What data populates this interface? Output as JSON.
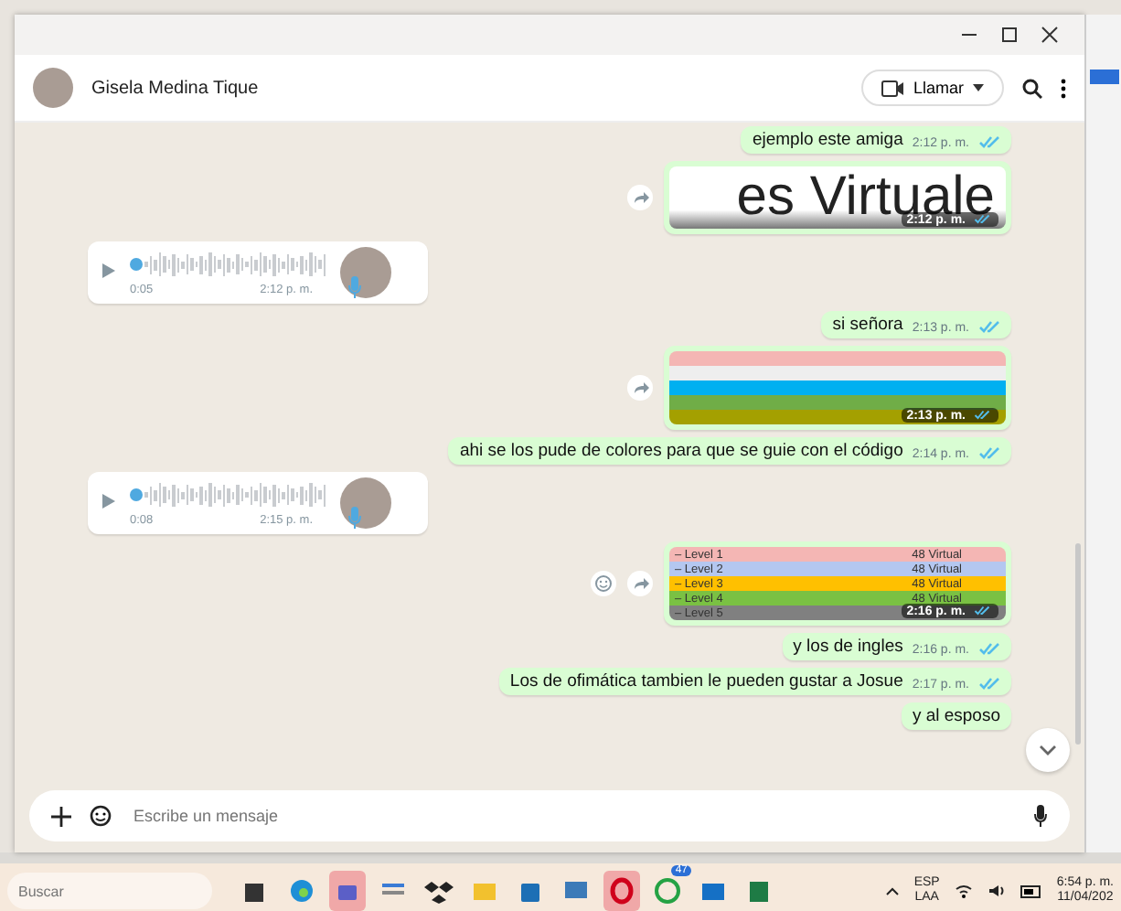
{
  "header": {
    "contact": "Gisela Medina Tique",
    "call_button": "Llamar"
  },
  "messages": [
    {
      "kind": "text",
      "outgoing": true,
      "text": "ejemplo este amiga",
      "time": "2:12 p. m.",
      "read": true
    },
    {
      "kind": "image",
      "outgoing": true,
      "text": "es Virtuale",
      "time": "2:12 p. m.",
      "read": true
    },
    {
      "kind": "audio",
      "outgoing": false,
      "duration": "0:05",
      "time": "2:12 p. m.",
      "level": 0
    },
    {
      "kind": "text",
      "outgoing": true,
      "text": "si señora",
      "time": "2:13 p. m.",
      "read": true
    },
    {
      "kind": "sheet",
      "outgoing": true,
      "time": "2:13 p. m.",
      "read": true,
      "rows": [
        {
          "color": "#f4b6b4"
        },
        {
          "color": "#eeeeee"
        },
        {
          "color": "#00b0f0"
        },
        {
          "color": "#70ad47"
        },
        {
          "color": "#a4a000"
        }
      ]
    },
    {
      "kind": "text",
      "outgoing": true,
      "text": "ahi se los pude de colores para que se guie con el código",
      "time": "2:14 p. m.",
      "read": true
    },
    {
      "kind": "audio",
      "outgoing": false,
      "duration": "0:08",
      "time": "2:15 p. m.",
      "level": 0
    },
    {
      "kind": "levels",
      "outgoing": true,
      "time": "2:16 p. m.",
      "read": true,
      "rows": [
        {
          "label": "– Level 1",
          "value": "48  Virtual",
          "color": "#f4b6b4"
        },
        {
          "label": "– Level 2",
          "value": "48  Virtual",
          "color": "#b4c7f0"
        },
        {
          "label": "– Level 3",
          "value": "48  Virtual",
          "color": "#ffc000"
        },
        {
          "label": "– Level 4",
          "value": "48  Virtual",
          "color": "#7ac143"
        },
        {
          "label": "– Level 5",
          "value": "",
          "color": "#808080"
        }
      ]
    },
    {
      "kind": "text",
      "outgoing": true,
      "text": "y los de ingles",
      "time": "2:16 p. m.",
      "read": true
    },
    {
      "kind": "text",
      "outgoing": true,
      "text": "Los de ofimática tambien le pueden gustar a Josue",
      "time": "2:17 p. m.",
      "read": true
    },
    {
      "kind": "text",
      "outgoing": true,
      "text": "y al esposo"
    }
  ],
  "composer": {
    "placeholder": "Escribe un mensaje"
  },
  "taskbar": {
    "search_placeholder": "Buscar",
    "apps": [
      {
        "kind": "widgets",
        "highlighted": false
      },
      {
        "kind": "edge",
        "highlighted": false
      },
      {
        "kind": "teams",
        "highlighted": true
      },
      {
        "kind": "files",
        "highlighted": false
      },
      {
        "kind": "dropbox",
        "highlighted": false
      },
      {
        "kind": "folder",
        "highlighted": false
      },
      {
        "kind": "store",
        "highlighted": false
      },
      {
        "kind": "windows",
        "highlighted": false
      },
      {
        "kind": "opera",
        "highlighted": true
      },
      {
        "kind": "whatsapp",
        "highlighted": false,
        "badge": "47"
      },
      {
        "kind": "outlook",
        "highlighted": false
      },
      {
        "kind": "excel",
        "highlighted": false
      }
    ],
    "language": "ESP",
    "layout": "LAA",
    "time": "6:54 p. m.",
    "date": "11/04/202"
  }
}
